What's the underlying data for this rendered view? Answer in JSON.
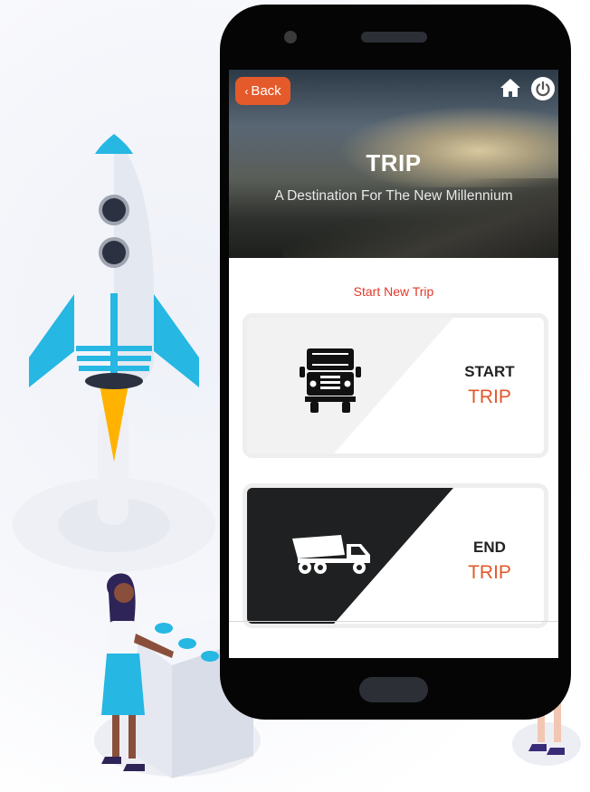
{
  "app": {
    "hero": {
      "title": "TRIP",
      "subtitle": "A Destination For The New Millennium"
    },
    "nav": {
      "back_label": "Back",
      "back_icon": "chevron-left-icon",
      "home_icon": "home-icon",
      "power_icon": "power-icon"
    },
    "section_title": "Start New Trip",
    "cards": [
      {
        "line1": "START",
        "line2": "TRIP",
        "icon": "truck-front-icon"
      },
      {
        "line1": "END",
        "line2": "TRIP",
        "icon": "dump-truck-icon"
      }
    ]
  },
  "colors": {
    "accent_orange": "#e55a2b",
    "section_title_red": "#e03a2a",
    "rocket_blue": "#26b7e3",
    "dark_panel": "#1f2021"
  }
}
